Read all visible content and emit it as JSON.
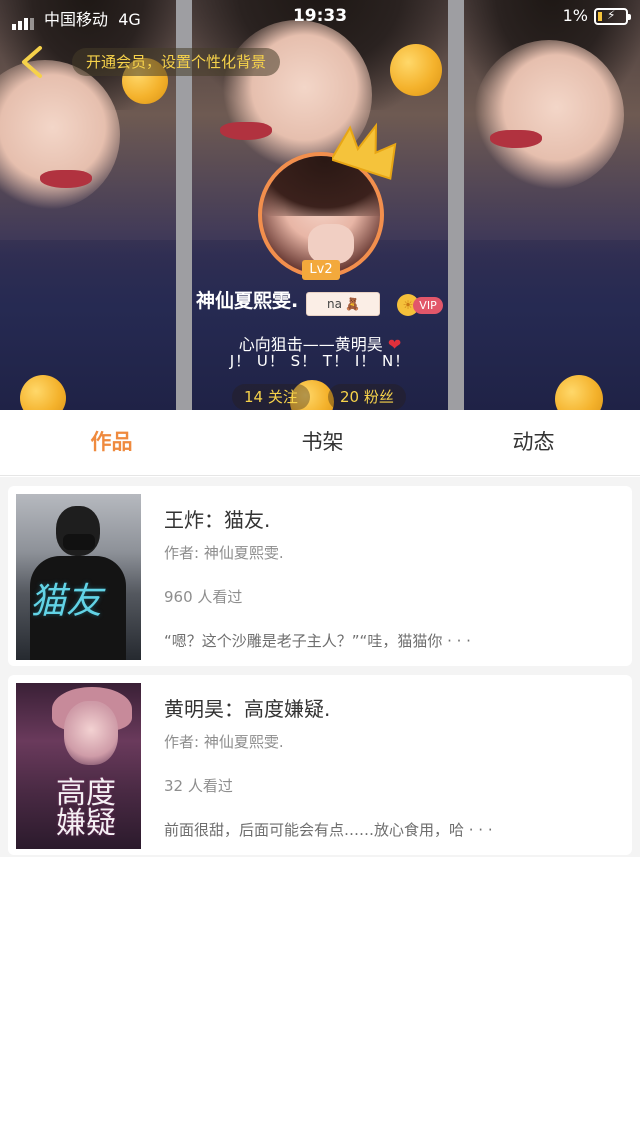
{
  "status_bar": {
    "carrier": "中国移动",
    "network": "4G",
    "time": "19:33",
    "battery_percent": "1%"
  },
  "header": {
    "vip_tip": "开通会员，设置个性化背景",
    "level": "Lv2",
    "username": "神仙夏熙雯.",
    "name_tag": "na",
    "vip_label": "VIP",
    "signature_line1": "心向狙击——黄明昊",
    "signature_line2": "J！ U！ S！ T！ I！ N！",
    "following": "14 关注",
    "followers": "20 粉丝",
    "accent_color": "#f28f4d",
    "gold_color": "#f6d24a"
  },
  "tabs": [
    {
      "label": "作品",
      "active": true
    },
    {
      "label": "书架",
      "active": false
    },
    {
      "label": "动态",
      "active": false
    }
  ],
  "works": [
    {
      "cover_text": "猫友",
      "title": "王炸：猫友.",
      "author": "作者: 神仙夏熙雯.",
      "views": "960 人看过",
      "excerpt": "“嗯？这个沙雕是老子主人？”“哇，猫猫你 · · ·"
    },
    {
      "cover_text": "高度嫌疑",
      "title": "黄明昊：高度嫌疑.",
      "author": "作者: 神仙夏熙雯.",
      "views": "32 人看过",
      "excerpt": "前面很甜，后面可能会有点……放心食用，哈 · · ·"
    }
  ],
  "icons": {
    "back": "chevron-left-icon",
    "crown": "crown-icon",
    "heart": "heart-icon",
    "vip": "sun-icon"
  }
}
